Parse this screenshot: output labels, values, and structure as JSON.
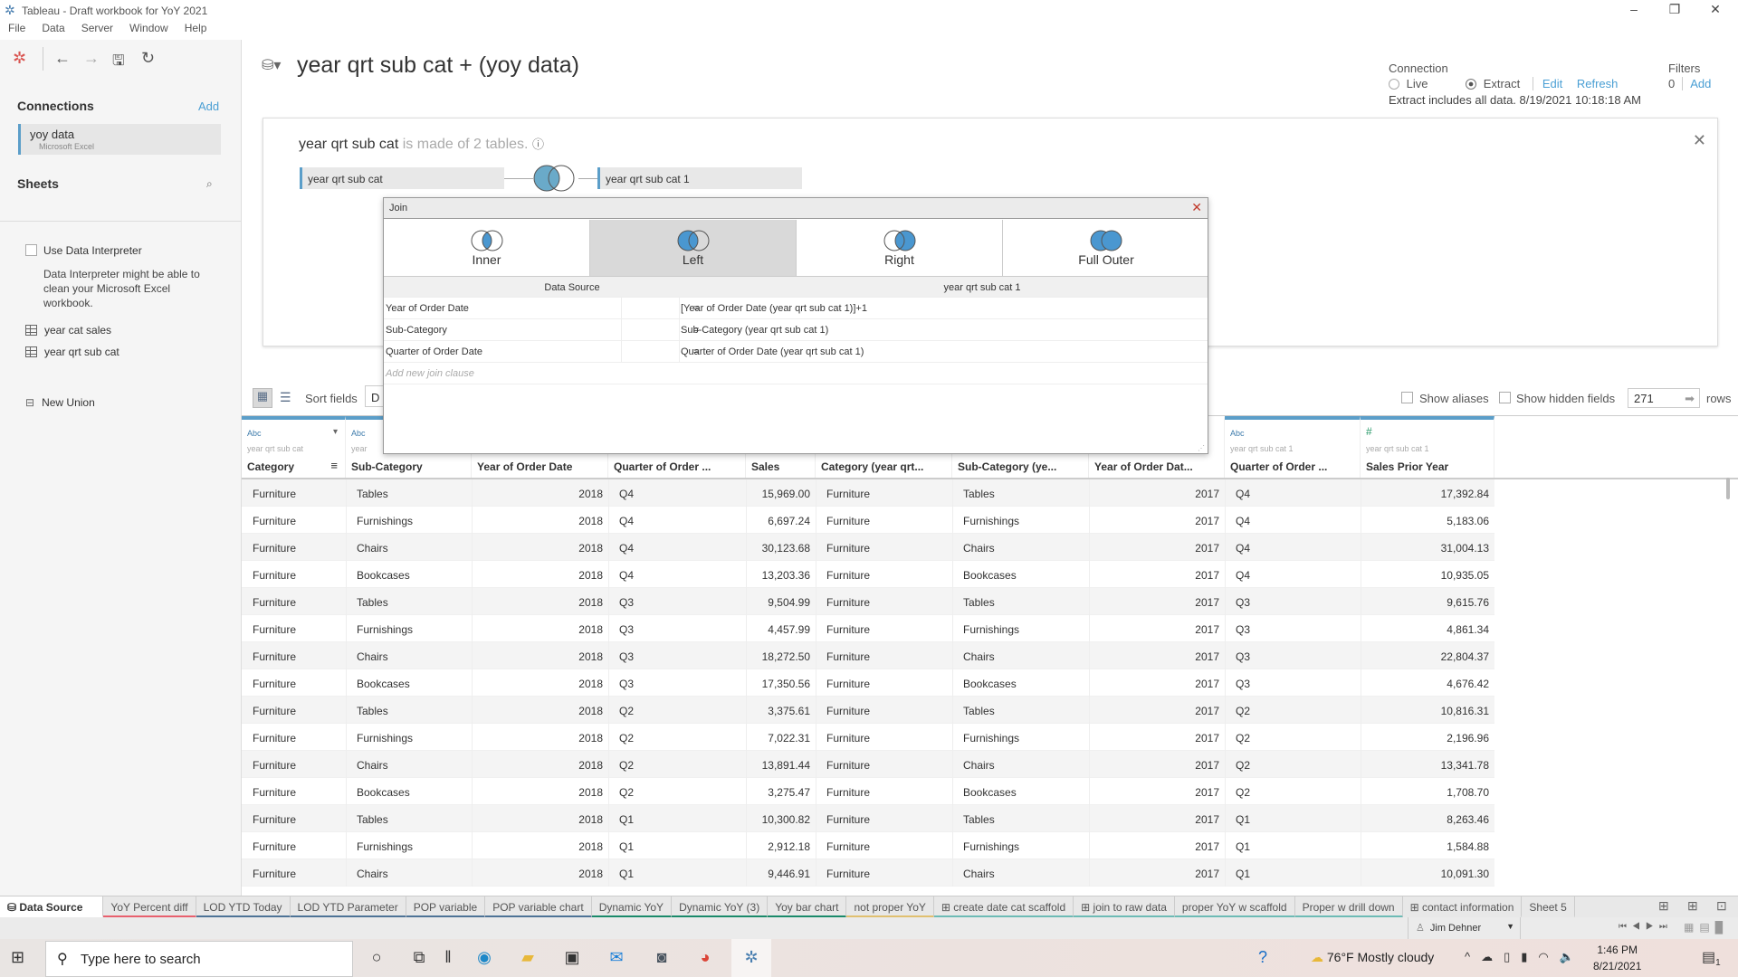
{
  "window": {
    "title": "Tableau - Draft workbook for YoY 2021"
  },
  "menu": [
    "File",
    "Data",
    "Server",
    "Window",
    "Help"
  ],
  "sidebar": {
    "connections_label": "Connections",
    "add_label": "Add",
    "connection": {
      "name": "yoy data",
      "type": "Microsoft Excel"
    },
    "sheets_label": "Sheets",
    "use_interpreter_label": "Use Data Interpreter",
    "interpreter_note": "Data Interpreter might be able to clean your Microsoft Excel workbook.",
    "sheets": [
      "year cat sales",
      "year qrt sub cat"
    ],
    "new_union_label": "New Union"
  },
  "header": {
    "title": "year qrt sub cat + (yoy data)",
    "connection_label": "Connection",
    "live_label": "Live",
    "extract_label": "Extract",
    "connection_mode": "Extract",
    "edit_label": "Edit",
    "refresh_label": "Refresh",
    "extract_note": "Extract includes all data. 8/19/2021 10:18:18 AM",
    "filters_label": "Filters",
    "filters_count": "0",
    "filters_add": "Add"
  },
  "canvas": {
    "table_name": "year qrt sub cat",
    "made_of": "is made of 2 tables.",
    "left_table": "year qrt sub cat",
    "right_table": "year qrt sub cat 1"
  },
  "join_dialog": {
    "title": "Join",
    "types": [
      "Inner",
      "Left",
      "Right",
      "Full Outer"
    ],
    "selected_type": "Left",
    "left_header": "Data Source",
    "right_header": "year qrt sub cat 1",
    "clauses": [
      {
        "left": "Year of Order Date",
        "op": "=",
        "right": "[Year of Order Date (year qrt sub cat 1)]+1"
      },
      {
        "left": "Sub-Category",
        "op": "=",
        "right": "Sub-Category (year qrt sub cat 1)"
      },
      {
        "left": "Quarter of Order Date",
        "op": "=",
        "right": "Quarter of Order Date (year qrt sub cat 1)"
      }
    ],
    "add_clause_placeholder": "Add new join clause"
  },
  "grid_toolbar": {
    "sort_label": "Sort fields",
    "sort_value": "D",
    "show_aliases": "Show aliases",
    "show_hidden": "Show hidden fields",
    "rows_value": "271",
    "rows_label": "rows"
  },
  "table": {
    "columns": [
      {
        "type": "Abc",
        "source": "year qrt sub cat",
        "name": "Category"
      },
      {
        "type": "Abc",
        "source": "year",
        "name": "Sub-Category"
      },
      {
        "type": "",
        "source": "",
        "name": "Year of Order Date"
      },
      {
        "type": "",
        "source": "",
        "name": "Quarter of Order ..."
      },
      {
        "type": "",
        "source": "",
        "name": "Sales"
      },
      {
        "type": "",
        "source": "",
        "name": "Category (year qrt..."
      },
      {
        "type": "",
        "source": "",
        "name": "Sub-Category (ye..."
      },
      {
        "type": "",
        "source": "",
        "name": "Year of Order Dat..."
      },
      {
        "type": "Abc",
        "source": "year qrt sub cat 1",
        "name": "Quarter of Order ..."
      },
      {
        "type": "#",
        "source": "year qrt sub cat 1",
        "name": "Sales Prior Year"
      }
    ],
    "rows": [
      [
        "Furniture",
        "Tables",
        "2018",
        "Q4",
        "15,969.00",
        "Furniture",
        "Tables",
        "2017",
        "Q4",
        "17,392.84"
      ],
      [
        "Furniture",
        "Furnishings",
        "2018",
        "Q4",
        "6,697.24",
        "Furniture",
        "Furnishings",
        "2017",
        "Q4",
        "5,183.06"
      ],
      [
        "Furniture",
        "Chairs",
        "2018",
        "Q4",
        "30,123.68",
        "Furniture",
        "Chairs",
        "2017",
        "Q4",
        "31,004.13"
      ],
      [
        "Furniture",
        "Bookcases",
        "2018",
        "Q4",
        "13,203.36",
        "Furniture",
        "Bookcases",
        "2017",
        "Q4",
        "10,935.05"
      ],
      [
        "Furniture",
        "Tables",
        "2018",
        "Q3",
        "9,504.99",
        "Furniture",
        "Tables",
        "2017",
        "Q3",
        "9,615.76"
      ],
      [
        "Furniture",
        "Furnishings",
        "2018",
        "Q3",
        "4,457.99",
        "Furniture",
        "Furnishings",
        "2017",
        "Q3",
        "4,861.34"
      ],
      [
        "Furniture",
        "Chairs",
        "2018",
        "Q3",
        "18,272.50",
        "Furniture",
        "Chairs",
        "2017",
        "Q3",
        "22,804.37"
      ],
      [
        "Furniture",
        "Bookcases",
        "2018",
        "Q3",
        "17,350.56",
        "Furniture",
        "Bookcases",
        "2017",
        "Q3",
        "4,676.42"
      ],
      [
        "Furniture",
        "Tables",
        "2018",
        "Q2",
        "3,375.61",
        "Furniture",
        "Tables",
        "2017",
        "Q2",
        "10,816.31"
      ],
      [
        "Furniture",
        "Furnishings",
        "2018",
        "Q2",
        "7,022.31",
        "Furniture",
        "Furnishings",
        "2017",
        "Q2",
        "2,196.96"
      ],
      [
        "Furniture",
        "Chairs",
        "2018",
        "Q2",
        "13,891.44",
        "Furniture",
        "Chairs",
        "2017",
        "Q2",
        "13,341.78"
      ],
      [
        "Furniture",
        "Bookcases",
        "2018",
        "Q2",
        "3,275.47",
        "Furniture",
        "Bookcases",
        "2017",
        "Q2",
        "1,708.70"
      ],
      [
        "Furniture",
        "Tables",
        "2018",
        "Q1",
        "10,300.82",
        "Furniture",
        "Tables",
        "2017",
        "Q1",
        "8,263.46"
      ],
      [
        "Furniture",
        "Furnishings",
        "2018",
        "Q1",
        "2,912.18",
        "Furniture",
        "Furnishings",
        "2017",
        "Q1",
        "1,584.88"
      ],
      [
        "Furniture",
        "Chairs",
        "2018",
        "Q1",
        "9,446.91",
        "Furniture",
        "Chairs",
        "2017",
        "Q1",
        "10,091.30"
      ]
    ]
  },
  "tabs": [
    {
      "label": "Data Source",
      "active": true,
      "color": ""
    },
    {
      "label": "YoY Percent diff",
      "color": "#e8606e"
    },
    {
      "label": "LOD YTD Today",
      "color": "#4e7396"
    },
    {
      "label": "LOD YTD Parameter",
      "color": "#4e7396"
    },
    {
      "label": "POP variable",
      "color": "#4e7396"
    },
    {
      "label": "POP variable chart",
      "color": "#4e7396"
    },
    {
      "label": "Dynamic YoY",
      "color": "#1a8a6a"
    },
    {
      "label": "Dynamic YoY (3)",
      "color": "#1a8a6a"
    },
    {
      "label": "Yoy bar chart",
      "color": "#1a8a6a"
    },
    {
      "label": "not proper YoY",
      "color": "#e0c070"
    },
    {
      "label": "create date cat scaffold",
      "color": "#6dbbb5",
      "dashboard": true
    },
    {
      "label": "join to raw data",
      "color": "#6dbbb5",
      "dashboard": true
    },
    {
      "label": "proper YoY w scaffold",
      "color": "#6dbbb5"
    },
    {
      "label": "Proper w drill down",
      "color": "#6dbbb5"
    },
    {
      "label": "contact information",
      "color": "",
      "dashboard": true
    },
    {
      "label": "Sheet 5",
      "color": ""
    }
  ],
  "status": {
    "user": "Jim Dehner"
  },
  "taskbar": {
    "search_placeholder": "Type here to search",
    "weather": "76°F  Mostly cloudy",
    "time": "1:46 PM",
    "date": "8/21/2021",
    "notifications": "1"
  },
  "colors": {
    "accent": "#5b9ec9",
    "link": "#4a9fd4",
    "venn": "#4a97d0"
  }
}
